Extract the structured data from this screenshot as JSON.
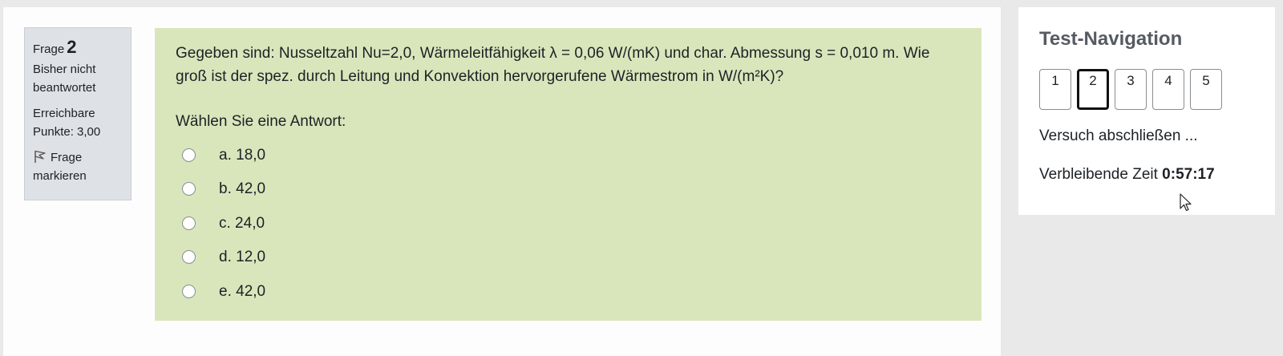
{
  "question_info": {
    "label": "Frage",
    "number": "2",
    "state": "Bisher nicht beantwortet",
    "grade": "Erreichbare Punkte: 3,00",
    "flag_label": "Frage markieren"
  },
  "question": {
    "text_line1": "Gegeben sind: Nusseltzahl Nu=2,0, Wärmeleitfähigkeit λ = 0,06 W/(mK) und char. Abmessung s = 0,010 m. Wie",
    "text_line2": "groß ist der spez. durch Leitung und Konvektion hervorgerufene Wärmestrom in W/(m²K)?",
    "prompt": "Wählen Sie eine Antwort:",
    "answers": [
      {
        "label": "a. 18,0",
        "selected": false
      },
      {
        "label": "b. 42,0",
        "selected": false
      },
      {
        "label": "c. 24,0",
        "selected": false
      },
      {
        "label": "d. 12,0",
        "selected": false
      },
      {
        "label": "e. 42,0",
        "selected": false
      }
    ]
  },
  "navigation": {
    "title": "Test-Navigation",
    "buttons": [
      "1",
      "2",
      "3",
      "4",
      "5"
    ],
    "current": "2",
    "finish_label": "Versuch abschließen ...",
    "timer_label": "Verbleibende Zeit",
    "timer_value": "0:57:17"
  },
  "colors": {
    "question_bg": "#d9e6bc",
    "info_bg": "#dee2e6",
    "page_bg": "#e9e9e9"
  }
}
